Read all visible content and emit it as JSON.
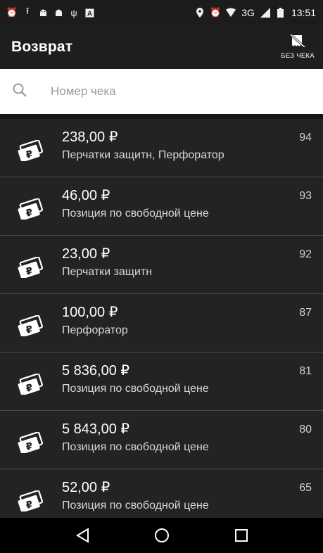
{
  "status_bar": {
    "time": "13:51",
    "network": "3G",
    "left_icons": [
      "alarm-icon",
      "upload-icon",
      "android-icon",
      "android-icon",
      "usb-icon",
      "a-icon"
    ],
    "right_icons": [
      "location-icon",
      "alarm-icon",
      "wifi-icon",
      "signal-icon",
      "battery-icon"
    ]
  },
  "appbar": {
    "title": "Возврат",
    "no_check_label": "БЕЗ ЧЕКА"
  },
  "search": {
    "placeholder": "Номер чека"
  },
  "receipts": [
    {
      "amount": "238,00 ₽",
      "description": "Перчатки защитн, Перфоратор",
      "number": "94"
    },
    {
      "amount": "46,00 ₽",
      "description": "Позиция по свободной цене",
      "number": "93"
    },
    {
      "amount": "23,00 ₽",
      "description": "Перчатки защитн",
      "number": "92"
    },
    {
      "amount": "100,00 ₽",
      "description": "Перфоратор",
      "number": "87"
    },
    {
      "amount": "5 836,00 ₽",
      "description": "Позиция по свободной цене",
      "number": "81"
    },
    {
      "amount": "5 843,00 ₽",
      "description": "Позиция по свободной цене",
      "number": "80"
    },
    {
      "amount": "52,00 ₽",
      "description": "Позиция по свободной цене",
      "number": "65"
    }
  ],
  "navbar": [
    "back-icon",
    "home-icon",
    "recents-icon"
  ],
  "colors": {
    "background": "#232323",
    "appbar": "#1e1e1e",
    "divider": "#4a4a4a",
    "search_bg": "#ffffff"
  }
}
